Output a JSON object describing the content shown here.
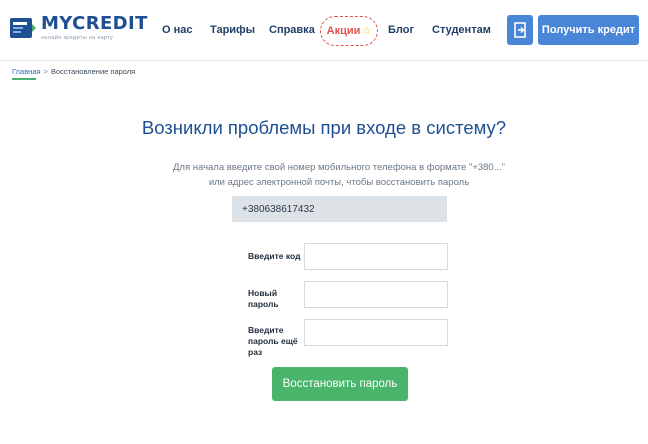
{
  "brand": {
    "name": "MYCREDIT",
    "tagline": "онлайн кредиты на карту",
    "color": "#1f4f93"
  },
  "nav": {
    "items": [
      {
        "label": "О нас"
      },
      {
        "label": "Тарифы"
      },
      {
        "label": "Справка"
      },
      {
        "label": "Блог"
      },
      {
        "label": "Студентам"
      }
    ],
    "promo": {
      "label": "Акции",
      "icon": "star-icon",
      "color": "#e0534f"
    },
    "login_icon": "login-icon",
    "cta_label": "Получить кредит",
    "cta_color": "#4a86d8"
  },
  "breadcrumb": {
    "home": "Главная",
    "separator": ">",
    "current": "Восстановление пароля"
  },
  "main": {
    "title": "Возникли проблемы при входе в систему?",
    "intro_line1": "Для начала введите свой номер мобильного телефона в формате \"+380...\"",
    "intro_line2": "или адрес электронной почты, чтобы восстановить пароль",
    "phone_value": "+380638617432",
    "form": {
      "code_label": "Введите код",
      "new_password_label_1": "Новый",
      "new_password_label_2": "пароль",
      "repeat_label_1": "Введите",
      "repeat_label_2": "пароль ещё",
      "repeat_label_3": "раз",
      "code_value": "",
      "new_password_value": "",
      "repeat_value": ""
    },
    "submit_label": "Восстановить пароль",
    "submit_color": "#48b56a"
  }
}
